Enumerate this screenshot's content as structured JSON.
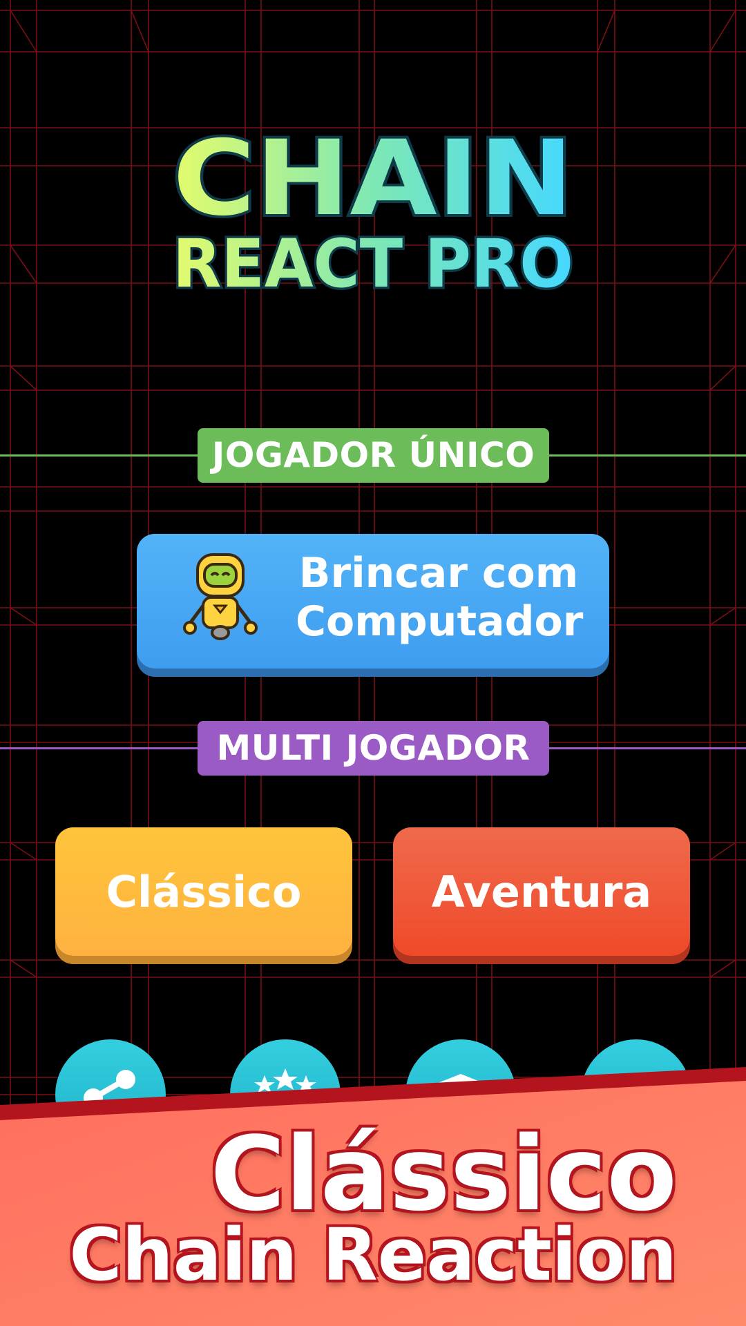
{
  "logo": {
    "line1": "CHAIN",
    "line2": "REACT PRO"
  },
  "single_player": {
    "section_label": "JOGADOR ÚNICO",
    "accent_color": "#6cbd5a",
    "computer_button_label_line1": "Brincar com",
    "computer_button_label_line2": "Computador",
    "computer_button_icon": "robot-icon"
  },
  "multi_player": {
    "section_label": "MULTI JOGADOR",
    "accent_color": "#9a5cc4",
    "classic_label": "Clássico",
    "adventure_label": "Aventura"
  },
  "bottom_icons": [
    "share-icon",
    "rating-stars-icon",
    "tutorial-cap-icon",
    "more-icon"
  ],
  "banner": {
    "title": "Clássico",
    "subtitle": "Chain Reaction",
    "color": "#ff7563"
  },
  "colors": {
    "background": "#000000",
    "grid_line": "#7a0f12",
    "computer_button": "#4ba8f4",
    "classic_button": "#ffbb3e",
    "adventure_button": "#ef5a3a",
    "round_button": "#28c0d6"
  }
}
